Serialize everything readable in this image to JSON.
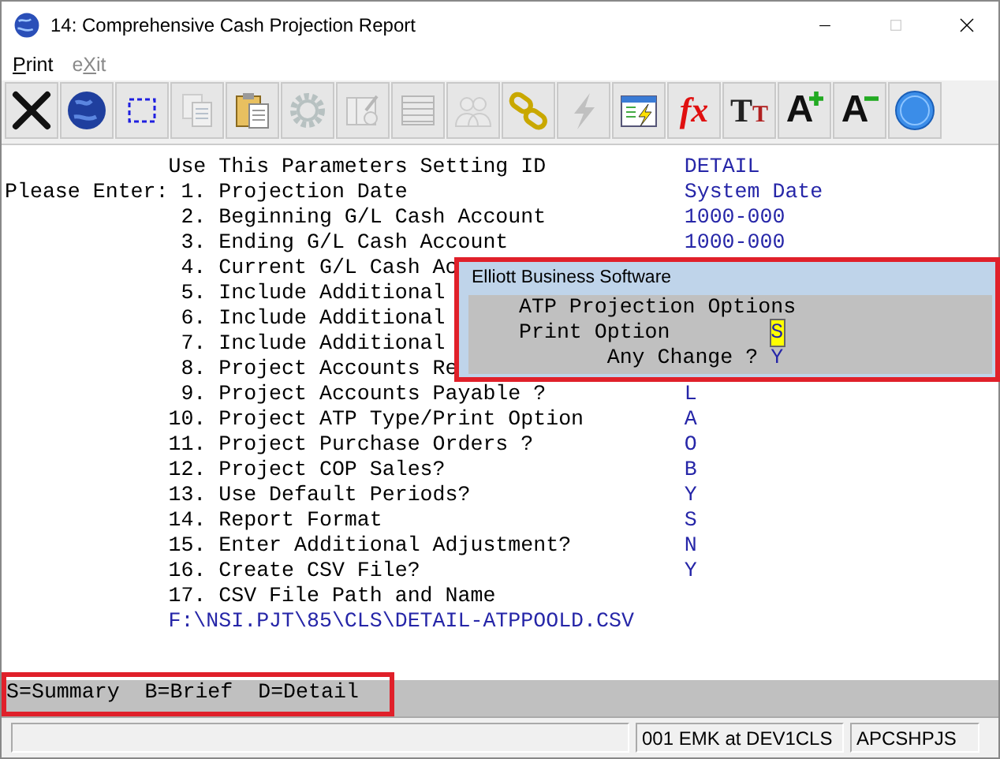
{
  "window": {
    "title": "14: Comprehensive Cash Projection Report"
  },
  "menu": [
    {
      "label": "Print",
      "disabled": false
    },
    {
      "label": "eXit",
      "disabled": true
    }
  ],
  "toolbar": [
    {
      "kind": "close",
      "disabled": false
    },
    {
      "kind": "globe",
      "disabled": false
    },
    {
      "kind": "select",
      "disabled": false
    },
    {
      "kind": "copy",
      "disabled": true
    },
    {
      "kind": "paste",
      "disabled": false
    },
    {
      "kind": "gear",
      "disabled": true
    },
    {
      "kind": "form",
      "disabled": true
    },
    {
      "kind": "table",
      "disabled": true
    },
    {
      "kind": "users",
      "disabled": true
    },
    {
      "kind": "link",
      "disabled": false
    },
    {
      "kind": "bolt",
      "disabled": true
    },
    {
      "kind": "launch",
      "disabled": false
    },
    {
      "kind": "fx",
      "glyph": "fx",
      "disabled": false
    },
    {
      "kind": "font",
      "glyph": "TT",
      "disabled": false
    },
    {
      "kind": "grow",
      "glyph": "A",
      "disabled": false
    },
    {
      "kind": "shrink",
      "glyph": "A",
      "disabled": false
    },
    {
      "kind": "help",
      "disabled": false
    }
  ],
  "form": {
    "rows": [
      {
        "kind": "header",
        "label": "Use This Parameters Setting ID",
        "value": "DETAIL"
      },
      {
        "kind": "item",
        "prompt": "Please Enter:",
        "number": "1.",
        "label": "Projection Date",
        "value": "System Date"
      },
      {
        "kind": "item",
        "number": "2.",
        "label": "Beginning G/L Cash Account",
        "value": "1000-000"
      },
      {
        "kind": "item",
        "number": "3.",
        "label": "Ending G/L Cash Account",
        "value": "1000-000"
      },
      {
        "kind": "item",
        "number": "4.",
        "label": "Current G/L Cash Ac"
      },
      {
        "kind": "item",
        "number": "5.",
        "label": "Include Additional"
      },
      {
        "kind": "item",
        "number": "6.",
        "label": "Include Additional"
      },
      {
        "kind": "item",
        "number": "7.",
        "label": "Include Additional"
      },
      {
        "kind": "item",
        "number": "8.",
        "label": "Project Accounts Re"
      },
      {
        "kind": "item",
        "number": "9.",
        "label": "Project Accounts Payable ?",
        "value": "L"
      },
      {
        "kind": "item",
        "number": "10.",
        "label": "Project ATP Type/Print Option",
        "value": "A"
      },
      {
        "kind": "item",
        "number": "11.",
        "label": "Project Purchase Orders ?",
        "value": "O"
      },
      {
        "kind": "item",
        "number": "12.",
        "label": "Project COP Sales?",
        "value": "B"
      },
      {
        "kind": "item",
        "number": "13.",
        "label": "Use Default Periods?",
        "value": "Y"
      },
      {
        "kind": "item",
        "number": "14.",
        "label": "Report Format",
        "value": "S"
      },
      {
        "kind": "item",
        "number": "15.",
        "label": "Enter Additional Adjustment?",
        "value": "N"
      },
      {
        "kind": "item",
        "number": "16.",
        "label": "Create CSV File?",
        "value": "Y"
      },
      {
        "kind": "item",
        "number": "17.",
        "label": "CSV File Path and Name"
      },
      {
        "kind": "path",
        "value": "F:\\NSI.PJT\\85\\CLS\\DETAIL-ATPPOOLD.CSV"
      }
    ]
  },
  "dialog": {
    "title": "Elliott Business Software",
    "heading": "ATP Projection Options",
    "fields": [
      {
        "label": "Print Option",
        "value": "S",
        "focused": true
      }
    ],
    "confirm": {
      "label": "Any Change ?",
      "value": "Y"
    }
  },
  "hint": "S=Summary  B=Brief  D=Detail",
  "status_bar": [
    "001 EMK at DEV1CLS",
    "APCSHPJS"
  ]
}
